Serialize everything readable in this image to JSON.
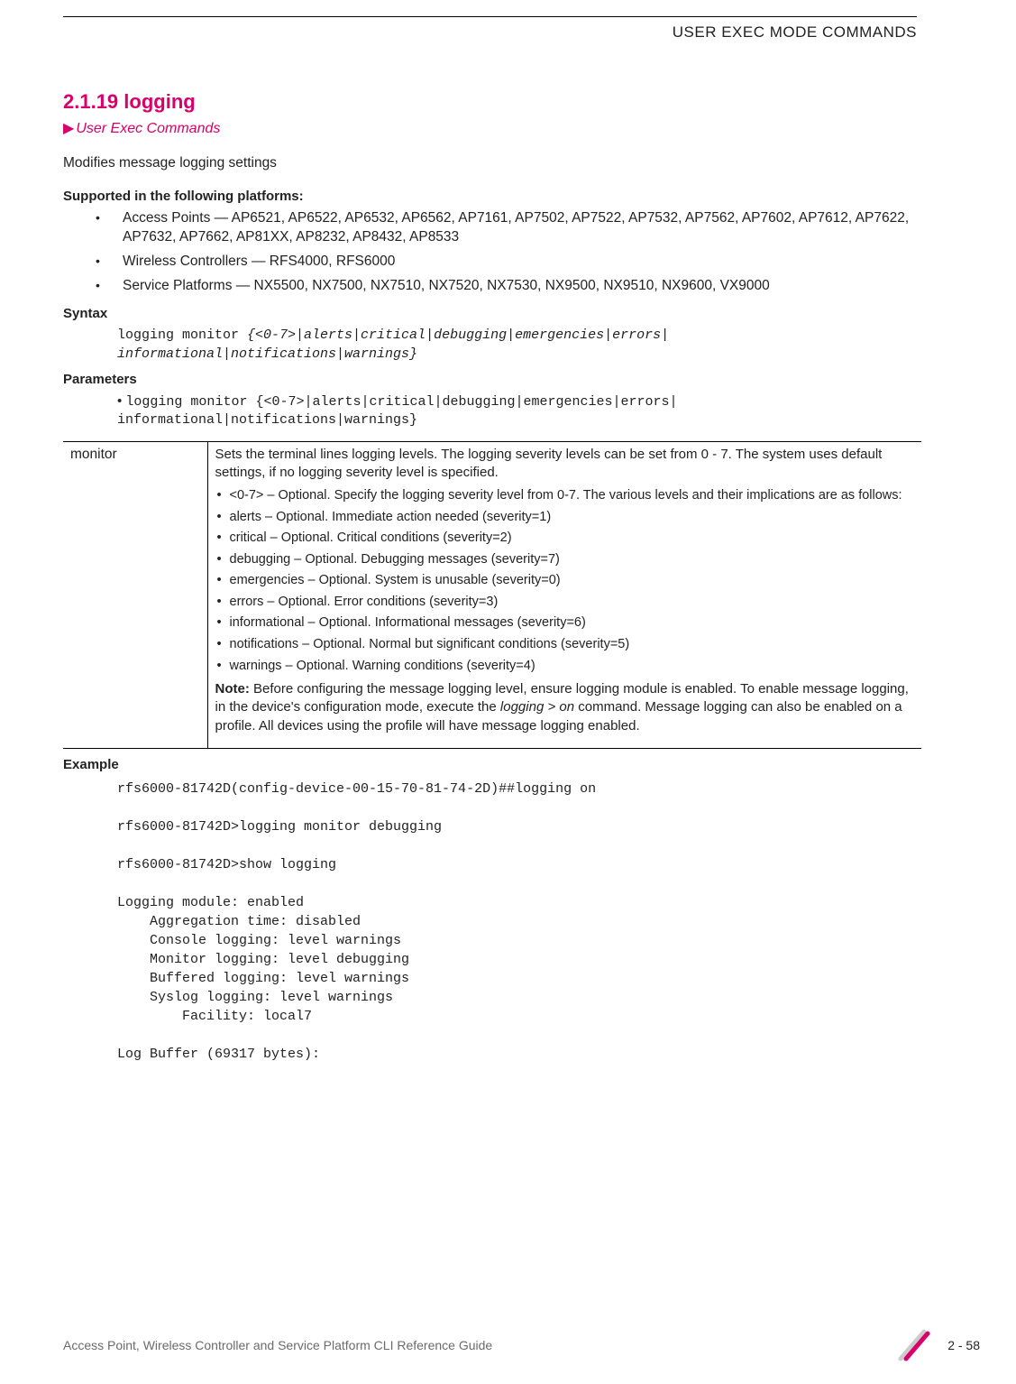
{
  "header": {
    "running_title": "USER EXEC MODE COMMANDS"
  },
  "section": {
    "number_title": "2.1.19 logging",
    "breadcrumb": "User Exec Commands"
  },
  "intro": "Modifies message logging settings",
  "platforms_head": "Supported in the following platforms:",
  "platforms": {
    "ap": "Access Points — AP6521, AP6522, AP6532, AP6562, AP7161, AP7502, AP7522, AP7532, AP7562, AP7602, AP7612, AP7622, AP7632, AP7662, AP81XX, AP8232, AP8432, AP8533",
    "wc": "Wireless Controllers — RFS4000, RFS6000",
    "sp": "Service Platforms — NX5500, NX7500, NX7510, NX7520, NX7530, NX9500, NX9510, NX9600, VX9000"
  },
  "syntax_head": "Syntax",
  "syntax": {
    "fixed": "logging monitor ",
    "args": "{<0-7>|alerts|critical|debugging|emergencies|errors|\ninformational|notifications|warnings}"
  },
  "parameters_head": "Parameters",
  "param_cmd": {
    "prefix": "• ",
    "fixed": "logging monitor ",
    "args": "{<0-7>|alerts|critical|debugging|emergencies|errors|\ninformational|notifications|warnings}"
  },
  "table": {
    "row1": {
      "c1": "monitor",
      "c2_intro": "Sets the terminal lines logging levels. The logging severity levels can be set from 0 - 7. The system uses default settings, if no logging severity level is specified.",
      "items": [
        "<0-7> – Optional. Specify the logging severity level from 0-7. The various levels and their implications are as follows:",
        "alerts – Optional. Immediate action needed (severity=1)",
        "critical – Optional. Critical conditions (severity=2)",
        "debugging – Optional. Debugging messages (severity=7)",
        "emergencies – Optional. System is unusable (severity=0)",
        "errors – Optional. Error conditions (severity=3)",
        "informational – Optional. Informational messages (severity=6)",
        "notifications – Optional. Normal but significant conditions (severity=5)",
        "warnings – Optional. Warning conditions (severity=4)"
      ],
      "note_label": "Note:",
      "note_body_a": " Before configuring the message logging level, ensure logging module is enabled. To enable message logging, in the device's configuration mode, execute the ",
      "note_ital": "logging > on",
      "note_body_b": " command. Message logging can also be enabled on a profile. All devices using the profile will have message logging enabled."
    }
  },
  "example_head": "Example",
  "example": "rfs6000-81742D(config-device-00-15-70-81-74-2D)##logging on\n\nrfs6000-81742D>logging monitor debugging\n\nrfs6000-81742D>show logging\n\nLogging module: enabled\n    Aggregation time: disabled\n    Console logging: level warnings\n    Monitor logging: level debugging\n    Buffered logging: level warnings\n    Syslog logging: level warnings\n        Facility: local7\n\nLog Buffer (69317 bytes):",
  "footer": {
    "guide": "Access Point, Wireless Controller and Service Platform CLI Reference Guide",
    "page": "2 - 58"
  }
}
